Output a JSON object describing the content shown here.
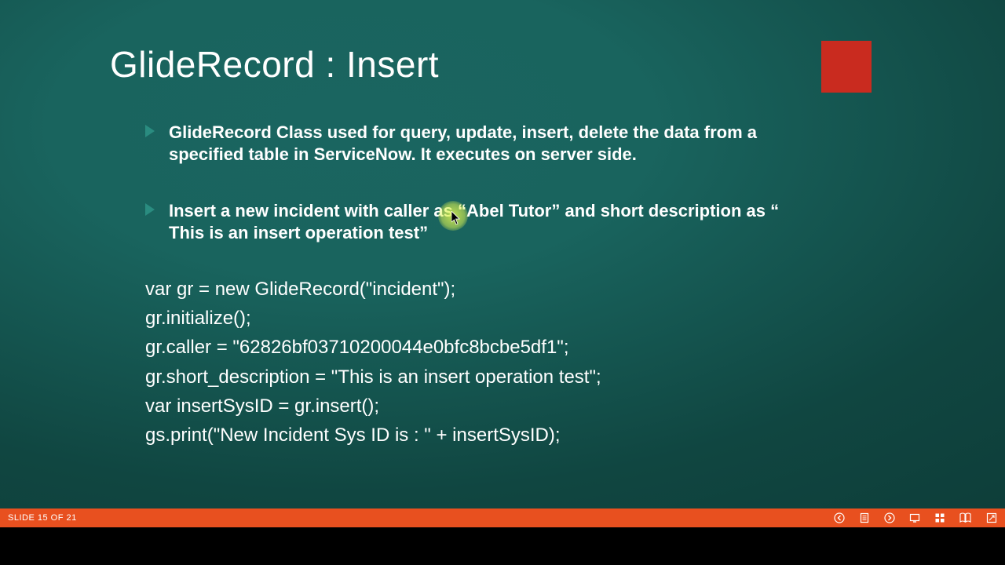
{
  "slide": {
    "title": "GlideRecord  : Insert",
    "bullets": [
      "GlideRecord Class used for query, update, insert, delete the data from a specified table in ServiceNow. It executes on server side.",
      "Insert a new incident with caller as “Abel Tutor” and short description as “ This is an insert operation test”"
    ],
    "code": [
      "var gr = new GlideRecord(\"incident\");",
      "gr.initialize();",
      "gr.caller = \"62826bf03710200044e0bfc8bcbe5df1\";",
      "gr.short_description = \"This is an insert operation test\";",
      "var insertSysID = gr.insert();",
      "gs.print(\"New Incident Sys ID is : \" + insertSysID);"
    ]
  },
  "status": {
    "label": "SLIDE 15 OF 21"
  }
}
